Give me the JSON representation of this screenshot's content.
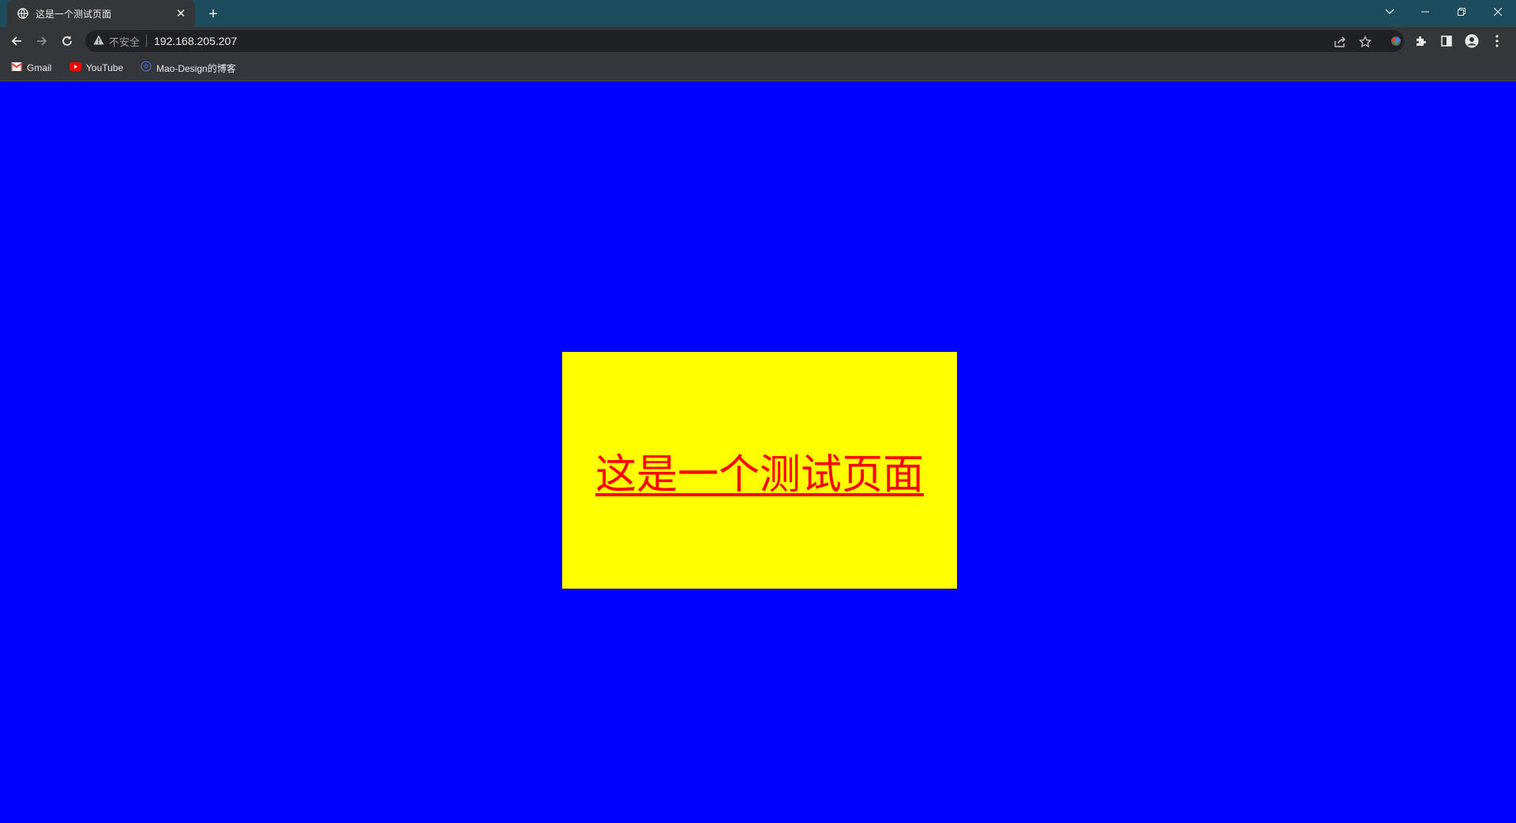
{
  "tab": {
    "title": "这是一个测试页面",
    "favicon": "globe-icon",
    "close_icon": "close-icon"
  },
  "new_tab_icon": "plus-icon",
  "window_controls": [
    "tab-search-icon",
    "minimize-icon",
    "restore-icon",
    "close-window-icon"
  ],
  "toolbar": {
    "back_icon": "back-arrow-icon",
    "forward_icon": "forward-arrow-icon",
    "reload_icon": "reload-icon",
    "security_icon": "warning-icon",
    "security_label": "不安全",
    "url": "192.168.205.207",
    "share_icon": "share-icon",
    "bookmark_icon": "star-icon",
    "extension_icons": [
      "extension-colorful-icon",
      "puzzle-icon",
      "side-panel-icon",
      "profile-icon",
      "menu-dots-icon"
    ]
  },
  "bookmarks": [
    {
      "label": "Gmail",
      "icon": "gmail-icon"
    },
    {
      "label": "YouTube",
      "icon": "youtube-icon"
    },
    {
      "label": "Mao-Design的博客",
      "icon": "blog-icon"
    }
  ],
  "page": {
    "background": "#0000ff",
    "box_color": "#ffff00",
    "link_color": "#ff0000",
    "link_text": "这是一个测试页面"
  }
}
